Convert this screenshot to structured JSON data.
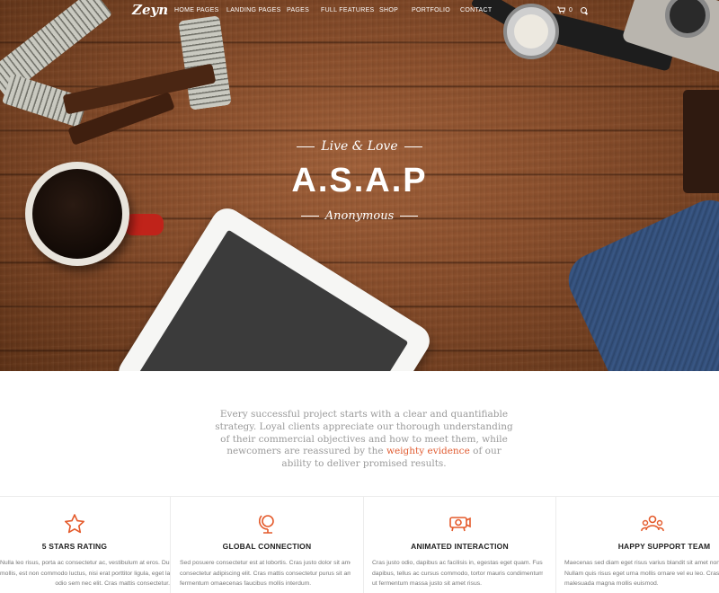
{
  "nav": {
    "logo": "Zeyn",
    "items": [
      "HOME PAGES",
      "LANDING PAGES",
      "PAGES",
      "FULL FEATURES",
      "SHOP",
      "PORTFOLIO",
      "CONTACT"
    ],
    "cart_count": "0",
    "icons": [
      "cart-icon",
      "search-icon"
    ]
  },
  "hero": {
    "eyebrow": "Live & Love",
    "headline": "A.S.A.P",
    "author": "Anonymous"
  },
  "intro": {
    "text_before": "Every successful project starts with a clear and quantifiable strategy.  Loyal clients appreciate our thorough understanding of their commercial objectives and how to meet them, while newcomers are reassured by the ",
    "highlight": "weighty evidence",
    "text_after": " of our ability to deliver promised results.",
    "accent_color": "#e05a2f"
  },
  "features": [
    {
      "icon": "star-icon",
      "title": "5 STARS RATING",
      "lines": [
        "Nulla leo risus, porta ac consectetur ac, vestibulum at eros. Duis",
        "mollis, est non commodo luctus, nisi erat porttitor ligula, eget lacinia",
        "odio sem nec elit. Cras mattis consectetur."
      ]
    },
    {
      "icon": "globe-icon",
      "title": "GLOBAL CONNECTION",
      "lines": [
        "Sed posuere consectetur est at lobortis. Cras justo dolor sit amet,",
        "consectetur adipiscing elit. Cras mattis consectetur purus sit amet",
        "fermentum omaecenas faucibus mollis interdum."
      ]
    },
    {
      "icon": "projector-icon",
      "title": "ANIMATED INTERACTION",
      "lines": [
        "Cras justo odio, dapibus ac facilisis in, egestas eget quam. Fusce",
        "dapibus, tellus ac cursus commodo, tortor mauris condimentum nibh,",
        "ut fermentum massa justo sit amet risus."
      ]
    },
    {
      "icon": "team-icon",
      "title": "HAPPY SUPPORT TEAM",
      "lines": [
        "Maecenas sed diam eget risus varius blandit sit amet non magna.",
        "Nullam quis risus eget urna mollis ornare vel eu leo. Cras mattis",
        "malesuada magna mollis euismod."
      ]
    }
  ]
}
